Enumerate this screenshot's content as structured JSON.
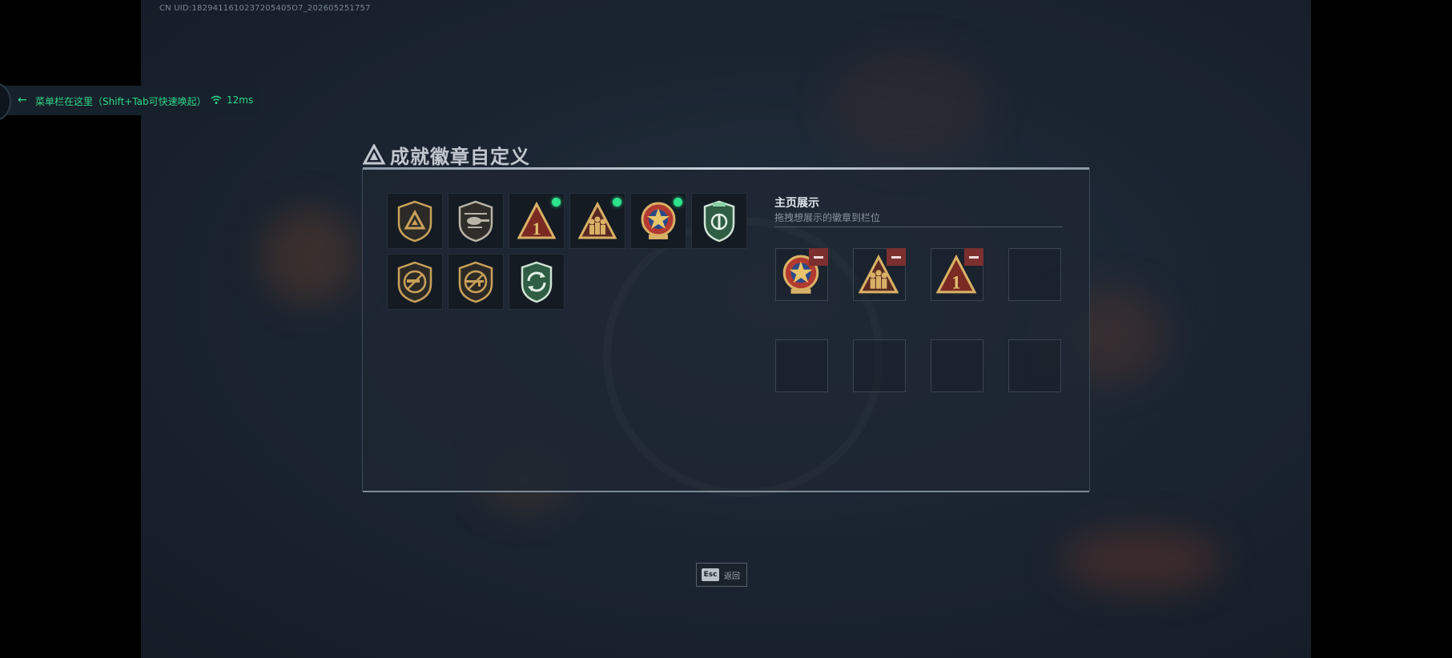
{
  "overlay": {
    "uid_text": "CN UID:1829411610237205405O7_202605251757",
    "menubar_text": "菜单栏在这里（Shift+Tab可快速唤起）",
    "ping": "12ms"
  },
  "window": {
    "title": "成就徽章自定义"
  },
  "inventory": {
    "badges": [
      {
        "icon": "triangle-shield-badge-icon",
        "has_new_dot": false
      },
      {
        "icon": "helicopter-shield-badge-icon",
        "has_new_dot": false
      },
      {
        "icon": "number-one-triangle-badge-icon",
        "has_new_dot": true
      },
      {
        "icon": "soldiers-triangle-badge-icon",
        "has_new_dot": true
      },
      {
        "icon": "star-medal-badge-icon",
        "has_new_dot": true
      },
      {
        "icon": "green-shield-badge-icon",
        "has_new_dot": false
      },
      {
        "icon": "no-gun-shield-badge-icon",
        "has_new_dot": false
      },
      {
        "icon": "no-rifle-shield-badge-icon",
        "has_new_dot": false
      },
      {
        "icon": "green-recycle-shield-badge-icon",
        "has_new_dot": false
      }
    ]
  },
  "showcase": {
    "title": "主页展示",
    "subtitle": "拖拽想展示的徽章到栏位",
    "slots": [
      {
        "icon": "star-medal-badge-icon",
        "filled": true
      },
      {
        "icon": "soldiers-triangle-badge-icon",
        "filled": true
      },
      {
        "icon": "number-one-triangle-badge-icon",
        "filled": true
      },
      {
        "icon": "",
        "filled": false
      },
      {
        "icon": "",
        "filled": false
      },
      {
        "icon": "",
        "filled": false
      },
      {
        "icon": "",
        "filled": false
      },
      {
        "icon": "",
        "filled": false
      }
    ]
  },
  "footer": {
    "esc_key": "Esc",
    "esc_label": "返回"
  },
  "colors": {
    "accent_green": "#2fd88a",
    "remove_red": "#7b2f2f",
    "badge_gold": "#c9a15a"
  }
}
